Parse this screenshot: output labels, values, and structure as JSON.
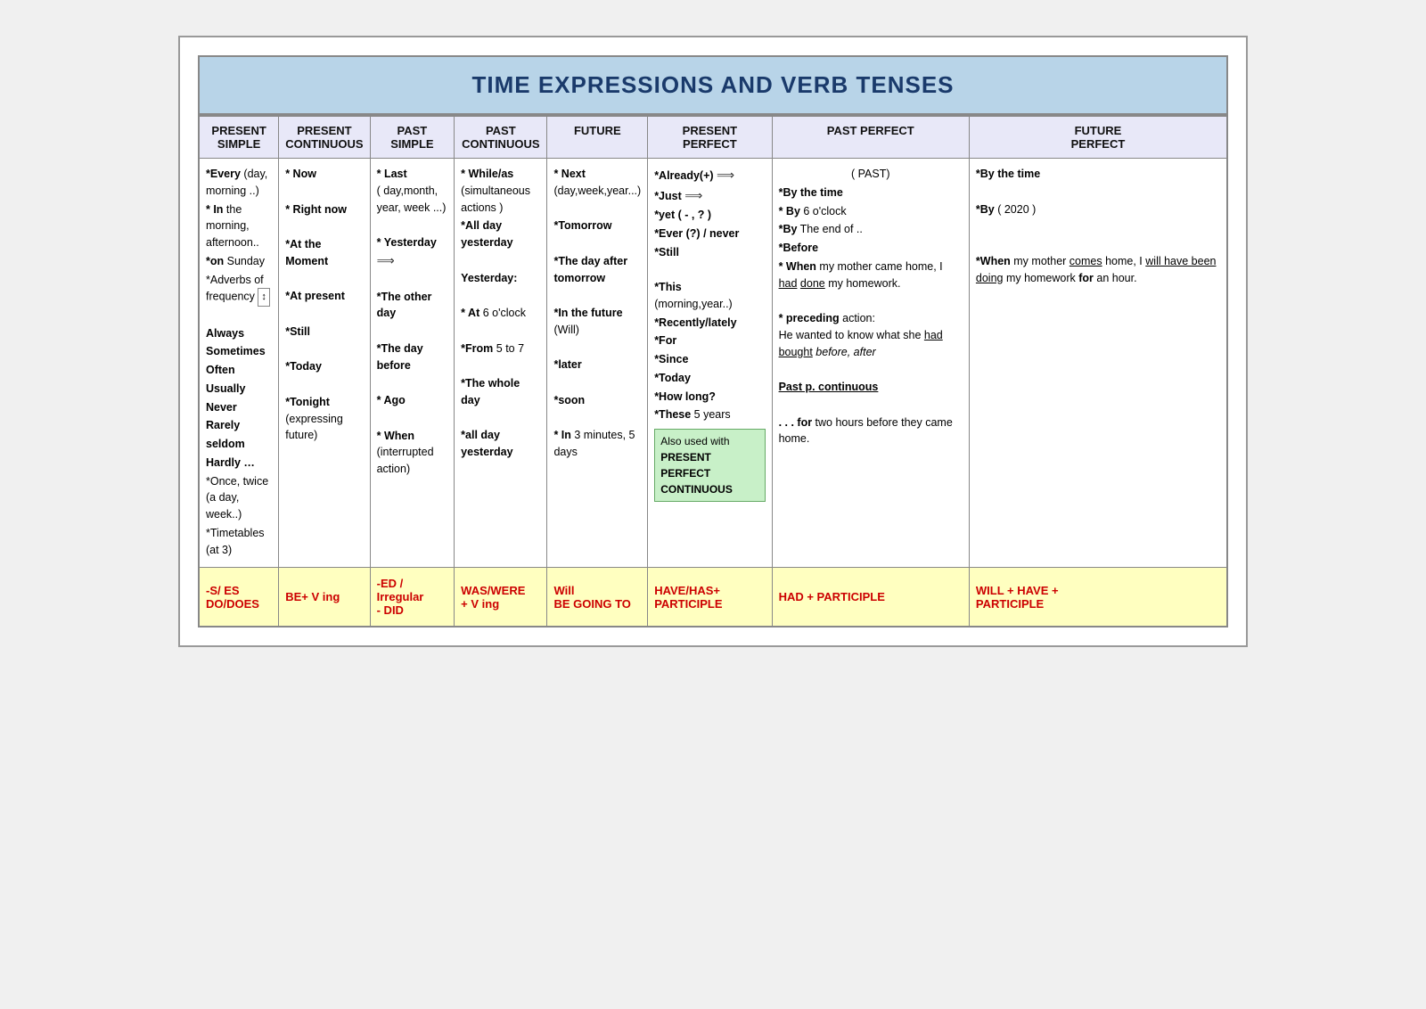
{
  "title": "TIME EXPRESSIONS AND VERB TENSES",
  "columns": [
    {
      "id": "present-simple",
      "line1": "PRESENT",
      "line2": "SIMPLE"
    },
    {
      "id": "present-continuous",
      "line1": "PRESENT",
      "line2": "CONTINUOUS"
    },
    {
      "id": "past-simple",
      "line1": "PAST SIMPLE",
      "line2": ""
    },
    {
      "id": "past-continuous",
      "line1": "PAST",
      "line2": "CONTINUOUS"
    },
    {
      "id": "future",
      "line1": "FUTURE",
      "line2": ""
    },
    {
      "id": "present-perfect",
      "line1": "PRESENT",
      "line2": "PERFECT"
    },
    {
      "id": "past-perfect",
      "line1": "PAST PERFECT",
      "line2": ""
    },
    {
      "id": "future-perfect",
      "line1": "FUTURE",
      "line2": "PERFECT"
    }
  ],
  "footer": [
    "-S/ ES\nDO/DOES",
    "BE+ V ing",
    "-ED / Irregular\n- DID",
    "WAS/WERE\n+ V ing",
    "Will\nBE GOING TO",
    "HAVE/HAS+\nPARTICIPLE",
    "HAD + PARTICIPLE",
    "WILL + HAVE +\nPARTICIPLE"
  ]
}
